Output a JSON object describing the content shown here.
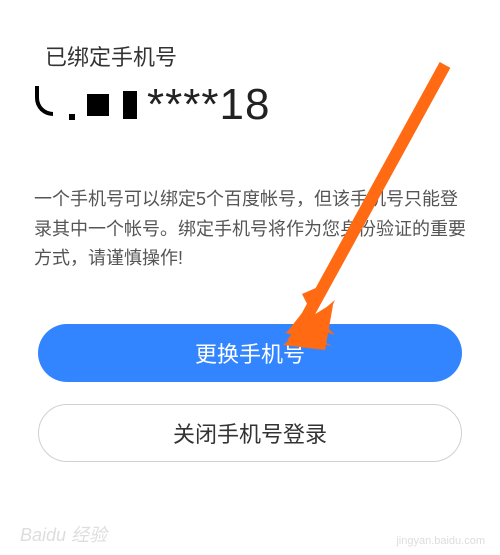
{
  "header": {
    "label": "已绑定手机号",
    "phone_masked_suffix": "****18"
  },
  "info": {
    "text": "一个手机号可以绑定5个百度帐号，但该手机号只能登录其中一个帐号。绑定手机号将作为您身份验证的重要方式，请谨慎操作!"
  },
  "buttons": {
    "change_phone": "更换手机号",
    "disable_phone_login": "关闭手机号登录"
  },
  "annotation": {
    "arrow_color": "#ff6a13"
  },
  "watermark": {
    "brand": "Baidu 经验",
    "url": "jingyan.baidu.com"
  }
}
